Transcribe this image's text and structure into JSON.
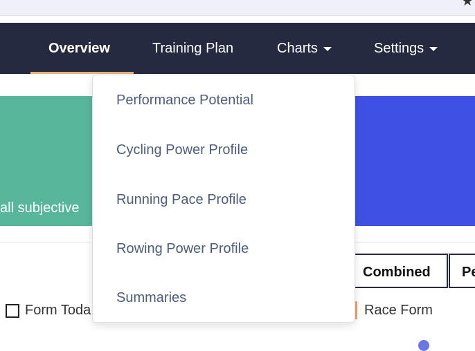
{
  "nav": {
    "items": [
      {
        "label": "Overview",
        "active": true
      },
      {
        "label": "Training Plan"
      },
      {
        "label": "Charts",
        "has_dropdown": true
      },
      {
        "label": "Settings",
        "has_dropdown": true
      }
    ]
  },
  "cards": {
    "green_text": "all subjective"
  },
  "tabs": {
    "combined": "Combined",
    "next": "Pe"
  },
  "legend": {
    "form_today": "Form Toda",
    "race_form": "Race Form"
  },
  "dropdown": {
    "items": [
      "Performance Potential",
      "Cycling Power Profile",
      "Running Pace Profile",
      "Rowing Power Profile",
      "Summaries"
    ]
  },
  "colors": {
    "navbar": "#252a40",
    "active_underline": "#e8b27a",
    "card_green": "#58b79b",
    "card_blue": "#3f51e3",
    "dropdown_text": "#4c5d7d"
  },
  "icons": {
    "bookmark": "star-icon",
    "caret": "chevron-down-icon"
  }
}
